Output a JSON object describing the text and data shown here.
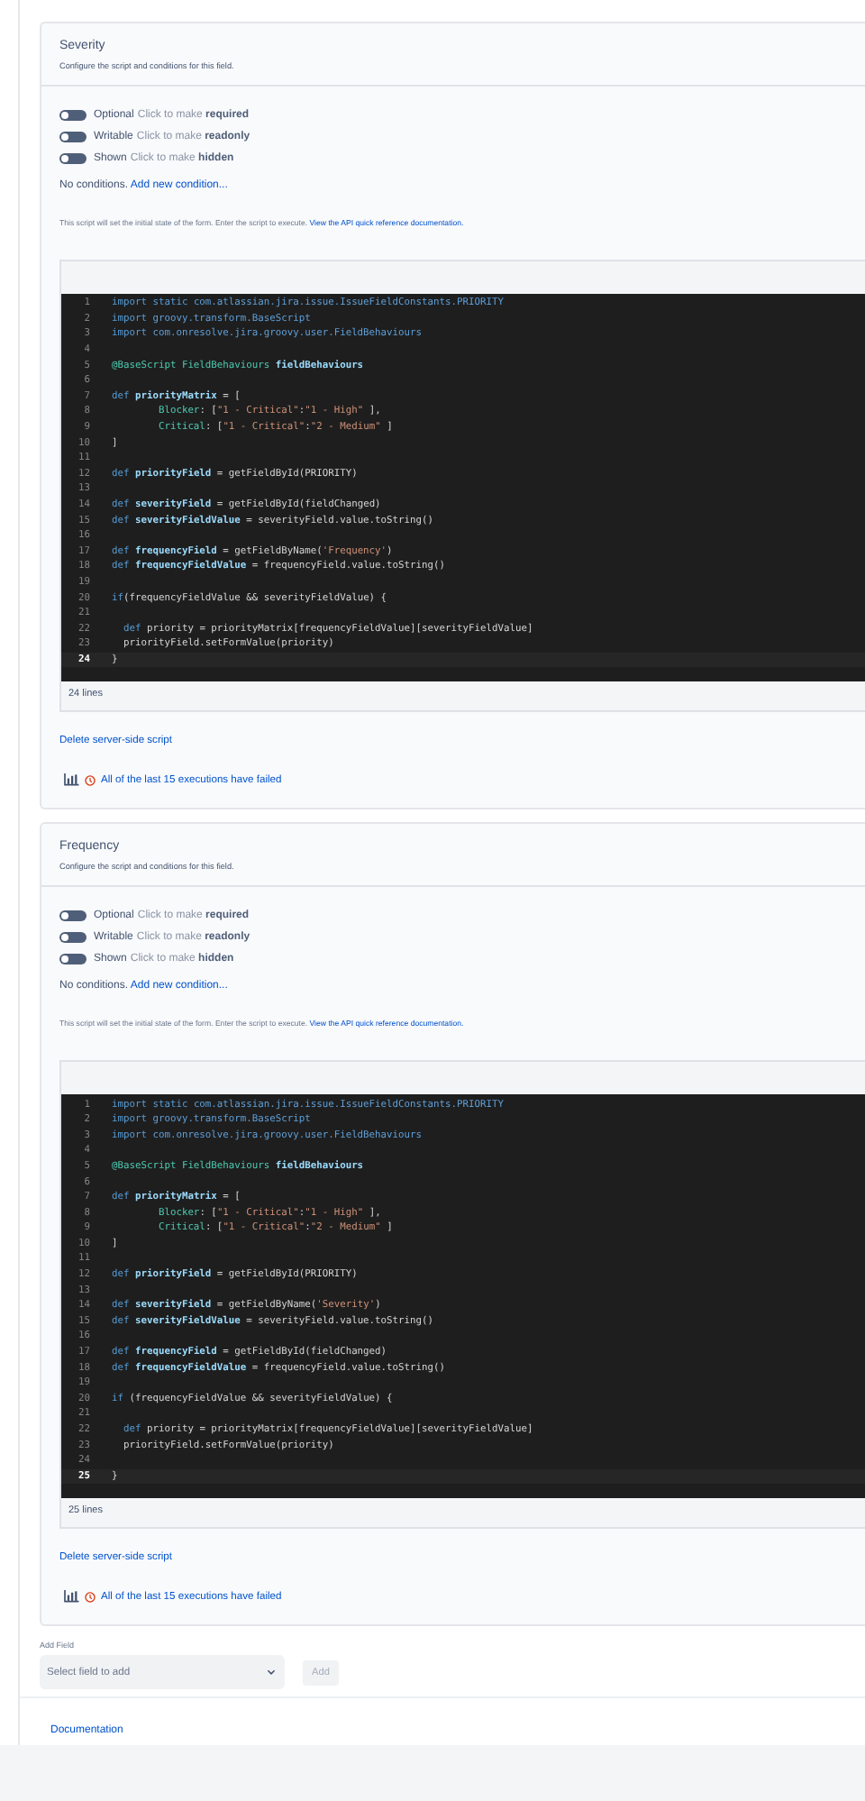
{
  "sections": [
    {
      "title": "Severity",
      "subtitle": "Configure the script and conditions for this field.",
      "toggles": [
        {
          "label": "Optional",
          "hint": "Click to make **required**",
          "on": false
        },
        {
          "label": "Writable",
          "hint": "Click to make **readonly**",
          "on": false
        },
        {
          "label": "Shown",
          "hint": "Click to make **hidden**",
          "on": false
        }
      ],
      "conditions_text": "No conditions.",
      "conditions_link": "Add new condition...",
      "help_text": "This script will set the initial state of the form. Enter the script to execute.",
      "help_link": "View the API quick reference documentation.",
      "code": [
        {
          "n": "1",
          "current": false,
          "tokens": [
            {
              "kind": "kw",
              "text": "import static "
            },
            {
              "kind": "id",
              "text": "com.atlassian.jira.issue.IssueFieldConstants.PRIORITY"
            }
          ]
        },
        {
          "n": "2",
          "current": false,
          "tokens": [
            {
              "kind": "kw",
              "text": "import "
            },
            {
              "kind": "id",
              "text": "groovy.transform.BaseScript"
            }
          ]
        },
        {
          "n": "3",
          "current": false,
          "tokens": [
            {
              "kind": "kw",
              "text": "import "
            },
            {
              "kind": "id",
              "text": "com.onresolve.jira.groovy.user.FieldBehaviours"
            }
          ]
        },
        {
          "n": "4",
          "current": false
        },
        {
          "n": "5",
          "current": false,
          "tokens": [
            {
              "kind": "ann",
              "text": "@BaseScript FieldBehaviours "
            },
            {
              "kind": "var",
              "text": "fieldBehaviours"
            }
          ]
        },
        {
          "n": "6",
          "current": false
        },
        {
          "n": "7",
          "current": false,
          "tokens": [
            {
              "kind": "kw",
              "text": "def "
            },
            {
              "kind": "var",
              "text": "priorityMatrix"
            },
            {
              "kind": "p",
              "text": " = ["
            }
          ]
        },
        {
          "n": "8",
          "current": false,
          "tokens": [
            {
              "kind": "ann",
              "text": "        Blocker"
            },
            {
              "kind": "p",
              "text": ": ["
            },
            {
              "kind": "str",
              "text": "\"1 - Critical\""
            },
            {
              "kind": "p",
              "text": ":"
            },
            {
              "kind": "str",
              "text": "\"1 - High\""
            },
            {
              "kind": "p",
              "text": " ],"
            }
          ]
        },
        {
          "n": "9",
          "current": false,
          "tokens": [
            {
              "kind": "ann",
              "text": "        Critical"
            },
            {
              "kind": "p",
              "text": ": ["
            },
            {
              "kind": "str",
              "text": "\"1 - Critical\""
            },
            {
              "kind": "p",
              "text": ":"
            },
            {
              "kind": "str",
              "text": "\"2 - Medium\""
            },
            {
              "kind": "p",
              "text": " ]"
            }
          ]
        },
        {
          "n": "10",
          "current": false,
          "tokens": [
            {
              "kind": "p",
              "text": "]"
            }
          ]
        },
        {
          "n": "11",
          "current": false
        },
        {
          "n": "12",
          "current": false,
          "tokens": [
            {
              "kind": "kw",
              "text": "def "
            },
            {
              "kind": "var",
              "text": "priorityField"
            },
            {
              "kind": "p",
              "text": " = getFieldById(PRIORITY)"
            }
          ]
        },
        {
          "n": "13",
          "current": false
        },
        {
          "n": "14",
          "current": false,
          "tokens": [
            {
              "kind": "kw",
              "text": "def "
            },
            {
              "kind": "var",
              "text": "severityField"
            },
            {
              "kind": "p",
              "text": " = getFieldById(fieldChanged)"
            }
          ]
        },
        {
          "n": "15",
          "current": false,
          "tokens": [
            {
              "kind": "kw",
              "text": "def "
            },
            {
              "kind": "var",
              "text": "severityFieldValue"
            },
            {
              "kind": "p",
              "text": " = severityField.value.toString()"
            }
          ]
        },
        {
          "n": "16",
          "current": false
        },
        {
          "n": "17",
          "current": false,
          "tokens": [
            {
              "kind": "kw",
              "text": "def "
            },
            {
              "kind": "var",
              "text": "frequencyField"
            },
            {
              "kind": "p",
              "text": " = getFieldByName("
            },
            {
              "kind": "str",
              "text": "'Frequency'"
            },
            {
              "kind": "p",
              "text": ")"
            }
          ]
        },
        {
          "n": "18",
          "current": false,
          "tokens": [
            {
              "kind": "kw",
              "text": "def "
            },
            {
              "kind": "var",
              "text": "frequencyFieldValue"
            },
            {
              "kind": "p",
              "text": " = frequencyField.value.toString()"
            }
          ]
        },
        {
          "n": "19",
          "current": false
        },
        {
          "n": "20",
          "current": false,
          "tokens": [
            {
              "kind": "kw",
              "text": "if"
            },
            {
              "kind": "p",
              "text": "(frequencyFieldValue && severityFieldValue) {"
            }
          ]
        },
        {
          "n": "21",
          "current": false
        },
        {
          "n": "22",
          "current": false,
          "tokens": [
            {
              "kind": "kw",
              "text": "  def "
            },
            {
              "kind": "p",
              "text": "priority = priorityMatrix[frequencyFieldValue][severityFieldValue]"
            }
          ]
        },
        {
          "n": "23",
          "current": false,
          "tokens": [
            {
              "kind": "p",
              "text": "  priorityField.setFormValue(priority)"
            }
          ]
        },
        {
          "n": "24",
          "current": true,
          "tokens": [
            {
              "kind": "p",
              "text": "}"
            }
          ]
        }
      ],
      "line_count": "24 lines",
      "delete_link": "Delete server-side script",
      "executions": "All of the last 15 executions have failed"
    },
    {
      "title": "Frequency",
      "subtitle": "Configure the script and conditions for this field.",
      "toggles": [
        {
          "label": "Optional",
          "hint": "Click to make **required**",
          "on": false
        },
        {
          "label": "Writable",
          "hint": "Click to make **readonly**",
          "on": false
        },
        {
          "label": "Shown",
          "hint": "Click to make **hidden**",
          "on": false
        }
      ],
      "conditions_text": "No conditions.",
      "conditions_link": "Add new condition...",
      "help_text": "This script will set the initial state of the form. Enter the script to execute.",
      "help_link": "View the API quick reference documentation.",
      "code": [
        {
          "n": "1",
          "current": false,
          "tokens": [
            {
              "kind": "kw",
              "text": "import static "
            },
            {
              "kind": "id",
              "text": "com.atlassian.jira.issue.IssueFieldConstants.PRIORITY"
            }
          ]
        },
        {
          "n": "2",
          "current": false,
          "tokens": [
            {
              "kind": "kw",
              "text": "import "
            },
            {
              "kind": "id",
              "text": "groovy.transform.BaseScript"
            }
          ]
        },
        {
          "n": "3",
          "current": false,
          "tokens": [
            {
              "kind": "kw",
              "text": "import "
            },
            {
              "kind": "id",
              "text": "com.onresolve.jira.groovy.user.FieldBehaviours"
            }
          ]
        },
        {
          "n": "4",
          "current": false
        },
        {
          "n": "5",
          "current": false,
          "tokens": [
            {
              "kind": "ann",
              "text": "@BaseScript FieldBehaviours "
            },
            {
              "kind": "var",
              "text": "fieldBehaviours"
            }
          ]
        },
        {
          "n": "6",
          "current": false
        },
        {
          "n": "7",
          "current": false,
          "tokens": [
            {
              "kind": "kw",
              "text": "def "
            },
            {
              "kind": "var",
              "text": "priorityMatrix"
            },
            {
              "kind": "p",
              "text": " = ["
            }
          ]
        },
        {
          "n": "8",
          "current": false,
          "tokens": [
            {
              "kind": "ann",
              "text": "        Blocker"
            },
            {
              "kind": "p",
              "text": ": ["
            },
            {
              "kind": "str",
              "text": "\"1 - Critical\""
            },
            {
              "kind": "p",
              "text": ":"
            },
            {
              "kind": "str",
              "text": "\"1 - High\""
            },
            {
              "kind": "p",
              "text": " ],"
            }
          ]
        },
        {
          "n": "9",
          "current": false,
          "tokens": [
            {
              "kind": "ann",
              "text": "        Critical"
            },
            {
              "kind": "p",
              "text": ": ["
            },
            {
              "kind": "str",
              "text": "\"1 - Critical\""
            },
            {
              "kind": "p",
              "text": ":"
            },
            {
              "kind": "str",
              "text": "\"2 - Medium\""
            },
            {
              "kind": "p",
              "text": " ]"
            }
          ]
        },
        {
          "n": "10",
          "current": false,
          "tokens": [
            {
              "kind": "p",
              "text": "]"
            }
          ]
        },
        {
          "n": "11",
          "current": false
        },
        {
          "n": "12",
          "current": false,
          "tokens": [
            {
              "kind": "kw",
              "text": "def "
            },
            {
              "kind": "var",
              "text": "priorityField"
            },
            {
              "kind": "p",
              "text": " = getFieldById(PRIORITY)"
            }
          ]
        },
        {
          "n": "13",
          "current": false
        },
        {
          "n": "14",
          "current": false,
          "tokens": [
            {
              "kind": "kw",
              "text": "def "
            },
            {
              "kind": "var",
              "text": "severityField"
            },
            {
              "kind": "p",
              "text": " = getFieldByName("
            },
            {
              "kind": "str",
              "text": "'Severity'"
            },
            {
              "kind": "p",
              "text": ")"
            }
          ]
        },
        {
          "n": "15",
          "current": false,
          "tokens": [
            {
              "kind": "kw",
              "text": "def "
            },
            {
              "kind": "var",
              "text": "severityFieldValue"
            },
            {
              "kind": "p",
              "text": " = severityField.value.toString()"
            }
          ]
        },
        {
          "n": "16",
          "current": false
        },
        {
          "n": "17",
          "current": false,
          "tokens": [
            {
              "kind": "kw",
              "text": "def "
            },
            {
              "kind": "var",
              "text": "frequencyField"
            },
            {
              "kind": "p",
              "text": " = getFieldById(fieldChanged)"
            }
          ]
        },
        {
          "n": "18",
          "current": false,
          "tokens": [
            {
              "kind": "kw",
              "text": "def "
            },
            {
              "kind": "var",
              "text": "frequencyFieldValue"
            },
            {
              "kind": "p",
              "text": " = frequencyField.value.toString()"
            }
          ]
        },
        {
          "n": "19",
          "current": false
        },
        {
          "n": "20",
          "current": false,
          "tokens": [
            {
              "kind": "kw",
              "text": "if"
            },
            {
              "kind": "p",
              "text": " (frequencyFieldValue && severityFieldValue) {"
            }
          ]
        },
        {
          "n": "21",
          "current": false
        },
        {
          "n": "22",
          "current": false,
          "tokens": [
            {
              "kind": "kw",
              "text": "  def "
            },
            {
              "kind": "p",
              "text": "priority = priorityMatrix[frequencyFieldValue][severityFieldValue]"
            }
          ]
        },
        {
          "n": "23",
          "current": false,
          "tokens": [
            {
              "kind": "p",
              "text": "  priorityField.setFormValue(priority)"
            }
          ]
        },
        {
          "n": "24",
          "current": false
        },
        {
          "n": "25",
          "current": true,
          "tokens": [
            {
              "kind": "p",
              "text": "}"
            }
          ]
        }
      ],
      "line_count": "25 lines",
      "delete_link": "Delete server-side script",
      "executions": "All of the last 15 executions have failed"
    }
  ],
  "add_field": {
    "label": "Add Field",
    "placeholder": "Select field to add",
    "button": "Add",
    "button_disabled": true
  },
  "documentation": "Documentation"
}
